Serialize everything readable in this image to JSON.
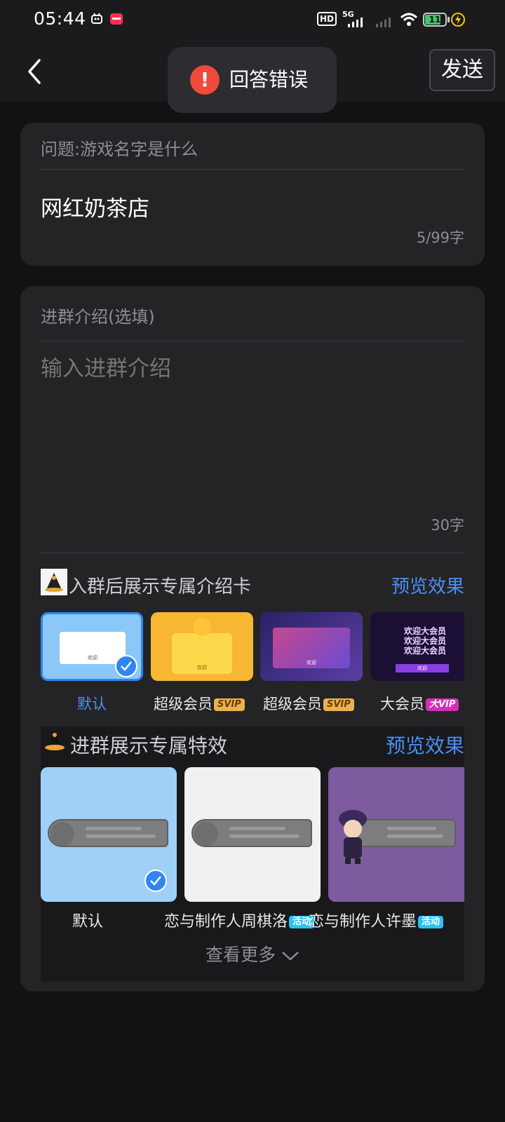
{
  "status_bar": {
    "time": "05:44",
    "hd_label": "HD",
    "net_label": "5G",
    "battery_level": "11"
  },
  "header": {
    "send_label": "发送"
  },
  "toast": {
    "message": "回答错误"
  },
  "question_card": {
    "question_label": "问题:游戏名字是什么",
    "answer_value": "网红奶茶店",
    "char_count": "5/99字"
  },
  "intro_card": {
    "label": "进群介绍(选填)",
    "placeholder": "输入进群介绍",
    "char_count": "30字"
  },
  "intro_card_section": {
    "title": "入群后展示专属介绍卡",
    "preview_label": "预览效果",
    "items": [
      {
        "label": "默认",
        "tag": "",
        "selected": true
      },
      {
        "label": "超级会员",
        "tag": "SVIP",
        "selected": false
      },
      {
        "label": "超级会员",
        "tag": "SVIP",
        "selected": false
      },
      {
        "label": "大会员",
        "tag": "大VIP",
        "selected": false
      }
    ],
    "thumb_text": {
      "default": "欢迎",
      "svip1": "欢迎",
      "svip2": "欢迎",
      "vip_lines": [
        "欢迎大会员",
        "欢迎大会员",
        "欢迎大会员"
      ],
      "vip_btn": "欢迎"
    }
  },
  "effects_section": {
    "title": "进群展示专属特效",
    "preview_label": "预览效果",
    "items": [
      {
        "label": "默认",
        "tag": "",
        "selected": true
      },
      {
        "label": "恋与制作人周棋洛",
        "tag": "活动",
        "selected": false
      },
      {
        "label": "恋与制作人许墨",
        "tag": "活动",
        "selected": false
      }
    ],
    "more_label": "查看更多"
  },
  "colors": {
    "accent": "#4c8ef5",
    "error": "#ef4a3a",
    "card_bg": "#242427",
    "page_bg": "#121214"
  }
}
